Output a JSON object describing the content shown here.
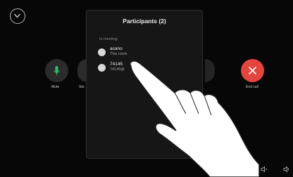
{
  "panel": {
    "title": "Participants (2)",
    "section_label": "In meeting",
    "participants": [
      {
        "name": "acano",
        "detail": "This room"
      },
      {
        "name": "74145",
        "detail": "74145@"
      }
    ]
  },
  "call_controls": {
    "mute_label": "Mute",
    "stop_label": "Sto",
    "end_label": "End call"
  },
  "colors": {
    "background": "#070707",
    "panel": "#161616",
    "end_call": "#e4463f"
  }
}
